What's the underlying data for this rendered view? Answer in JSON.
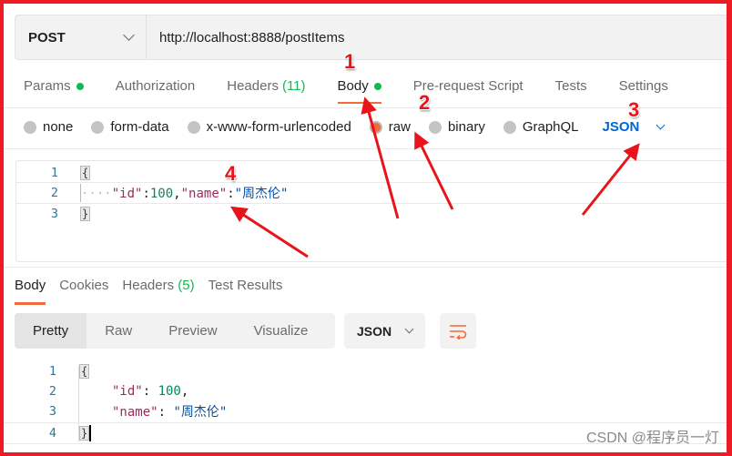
{
  "request": {
    "method": "POST",
    "url": "http://localhost:8888/postItems"
  },
  "request_tabs": [
    {
      "label": "Params",
      "has_dot": true
    },
    {
      "label": "Authorization"
    },
    {
      "label": "Headers",
      "count": "(11)"
    },
    {
      "label": "Body",
      "has_dot": true,
      "active": true
    },
    {
      "label": "Pre-request Script"
    },
    {
      "label": "Tests"
    },
    {
      "label": "Settings"
    }
  ],
  "body_types": [
    {
      "label": "none",
      "selected": false
    },
    {
      "label": "form-data",
      "selected": false
    },
    {
      "label": "x-www-form-urlencoded",
      "selected": false
    },
    {
      "label": "raw",
      "selected": true
    },
    {
      "label": "binary",
      "selected": false
    },
    {
      "label": "GraphQL",
      "selected": false
    }
  ],
  "raw_language": "JSON",
  "request_body": {
    "line_numbers": [
      "1",
      "2",
      "3"
    ],
    "open_brace": "{",
    "close_brace": "}",
    "indent_dots": "····",
    "key_id": "\"id\"",
    "colon": ":",
    "value_id": "100",
    "comma": ",",
    "key_name": "\"name\"",
    "value_name": "\"周杰伦\""
  },
  "response_tabs": [
    {
      "label": "Body",
      "active": true
    },
    {
      "label": "Cookies"
    },
    {
      "label": "Headers",
      "count": "(5)"
    },
    {
      "label": "Test Results"
    }
  ],
  "view_modes": [
    "Pretty",
    "Raw",
    "Preview",
    "Visualize"
  ],
  "active_view_mode": "Pretty",
  "response_format": "JSON",
  "response_body": {
    "line_numbers": [
      "1",
      "2",
      "3",
      "4"
    ],
    "open_brace": "{",
    "close_brace": "}",
    "key_id": "\"id\"",
    "value_id": "100",
    "key_name": "\"name\"",
    "value_name": "\"周杰伦\""
  },
  "annotations": [
    "1",
    "2",
    "3",
    "4"
  ],
  "watermark": "CSDN @程序员一灯",
  "colors": {
    "accent": "#f26b3a",
    "green_dot": "#0cbb52",
    "link_blue": "#0265d2",
    "annotation_red": "#e8141b"
  }
}
